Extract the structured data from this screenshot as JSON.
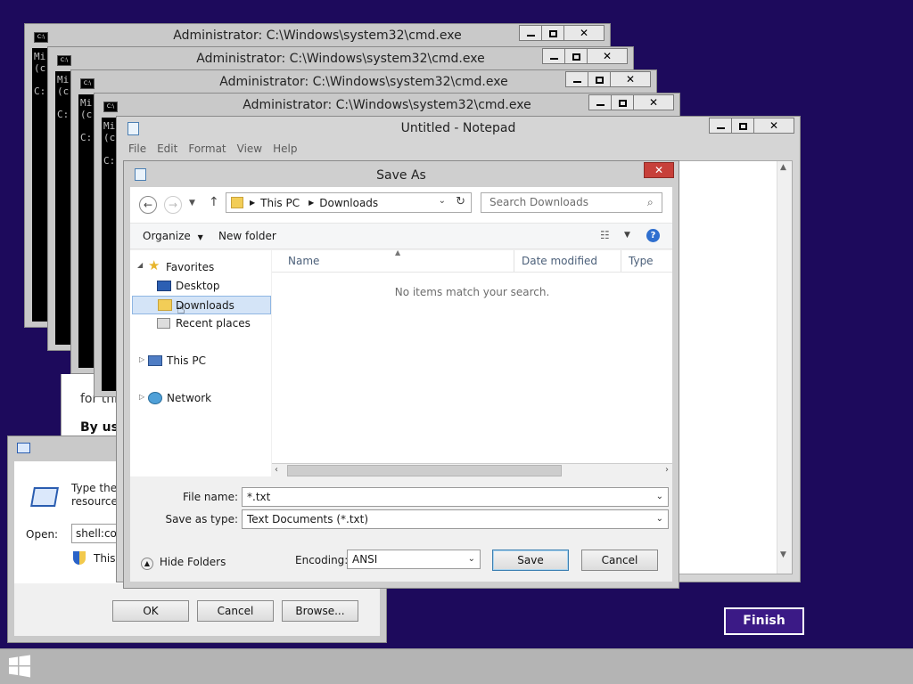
{
  "cmd_windows": [
    {
      "title": "Administrator: C:\\Windows\\system32\\cmd.exe"
    },
    {
      "title": "Administrator: C:\\Windows\\system32\\cmd.exe"
    },
    {
      "title": "Administrator: C:\\Windows\\system32\\cmd.exe"
    },
    {
      "title": "Administrator: C:\\Windows\\system32\\cmd.exe"
    }
  ],
  "cmd_text_fragment": "Mi\n(c\n\nC:",
  "notepad": {
    "title": "Untitled - Notepad",
    "menu": [
      "File",
      "Edit",
      "Format",
      "View",
      "Help"
    ]
  },
  "behind_text": {
    "line1": "for thi",
    "line2": "By usi"
  },
  "save_as": {
    "title": "Save As",
    "breadcrumb": [
      "This PC",
      "Downloads"
    ],
    "search_placeholder": "Search Downloads",
    "organize_label": "Organize",
    "new_folder_label": "New folder",
    "tree": {
      "favorites": "Favorites",
      "desktop": "Desktop",
      "downloads": "Downloads",
      "recent": "Recent places",
      "this_pc": "This PC",
      "network": "Network"
    },
    "columns": [
      "Name",
      "Date modified",
      "Type"
    ],
    "empty_message": "No items match your search.",
    "file_name_label": "File name:",
    "file_name_value": "*.txt",
    "save_type_label": "Save as type:",
    "save_type_value": "Text Documents (*.txt)",
    "hide_folders_label": "Hide Folders",
    "encoding_label": "Encoding:",
    "encoding_value": "ANSI",
    "save_label": "Save",
    "cancel_label": "Cancel"
  },
  "run_dialog": {
    "desc_line1": "Type the r",
    "desc_line2": "resource, ",
    "open_label": "Open:",
    "open_value": "shell:con",
    "admin_note": "This t",
    "ok_label": "OK",
    "cancel_label": "Cancel",
    "browse_label": "Browse..."
  },
  "finish_label": "Finish",
  "colors": {
    "desktop": "#1d0a5c",
    "finish_button": "#3b1a86",
    "close_button": "#c7403a"
  }
}
